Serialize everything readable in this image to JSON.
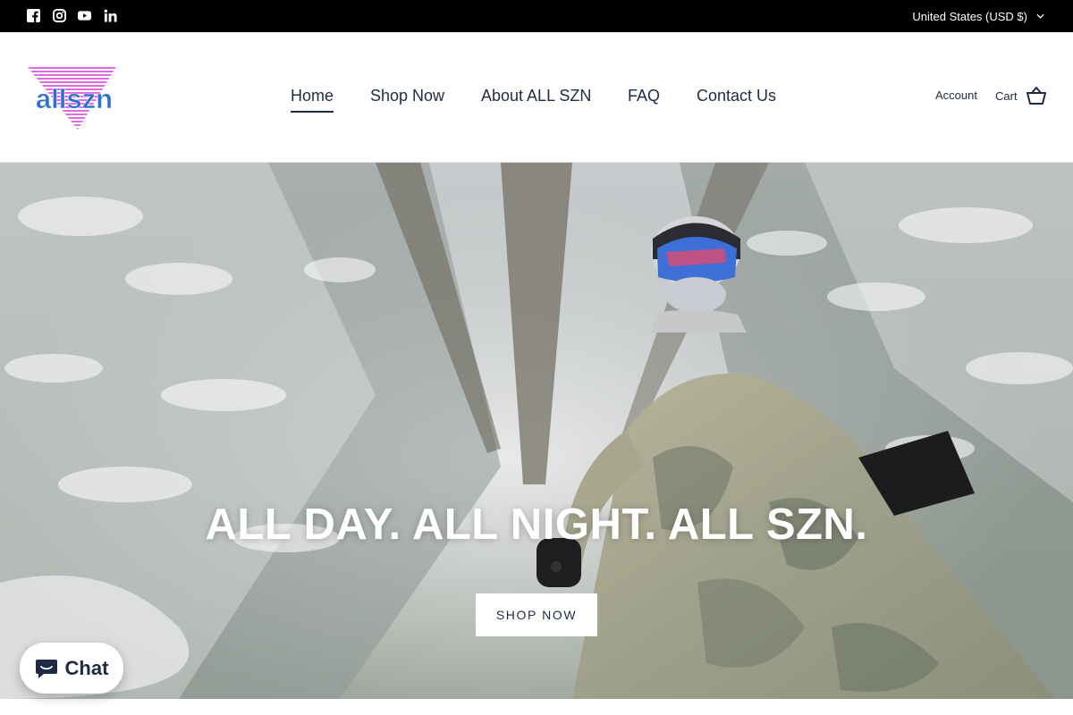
{
  "topbar": {
    "social": [
      {
        "name": "facebook-icon",
        "label": "Facebook"
      },
      {
        "name": "instagram-icon",
        "label": "Instagram"
      },
      {
        "name": "youtube-icon",
        "label": "YouTube"
      },
      {
        "name": "linkedin-icon",
        "label": "LinkedIn"
      }
    ],
    "currency_label": "United States (USD $)"
  },
  "header": {
    "logo_text": "allszn",
    "nav": [
      {
        "label": "Home",
        "active": true
      },
      {
        "label": "Shop Now",
        "active": false
      },
      {
        "label": "About ALL SZN",
        "active": false
      },
      {
        "label": "FAQ",
        "active": false
      },
      {
        "label": "Contact Us",
        "active": false
      }
    ],
    "account_label": "Account",
    "cart_label": "Cart"
  },
  "hero": {
    "title": "ALL DAY. ALL NIGHT. ALL SZN.",
    "button_label": "SHOP NOW"
  },
  "chat": {
    "label": "Chat"
  },
  "colors": {
    "topbar_bg": "#000000",
    "nav_text": "#1f2a44",
    "logo_pink": "#d33bd6",
    "logo_blue": "#2f6fd1"
  }
}
